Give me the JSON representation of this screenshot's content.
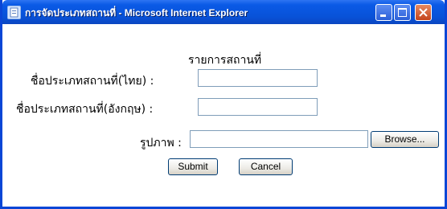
{
  "window": {
    "title": "การจัดประเภทสถานที่ - Microsoft Internet Explorer",
    "icons": {
      "app": "ie-page-icon",
      "minimize": "minimize-icon",
      "maximize": "maximize-icon",
      "close": "close-icon"
    },
    "colors": {
      "titlebar": "#0852d8",
      "close_button": "#c4441c",
      "border": "#0a46d6"
    }
  },
  "form": {
    "heading": "รายการสถานที่",
    "thai_name_label": "ชื่อประเภทสถานที่(ไทย) :",
    "thai_name_value": "",
    "english_name_label": "ชื่อประเภทสถานที่(อังกฤษ) :",
    "english_name_value": "",
    "picture_label": "รูปภาพ :",
    "picture_value": "",
    "browse_label": "Browse...",
    "submit_label": "Submit",
    "cancel_label": "Cancel"
  }
}
